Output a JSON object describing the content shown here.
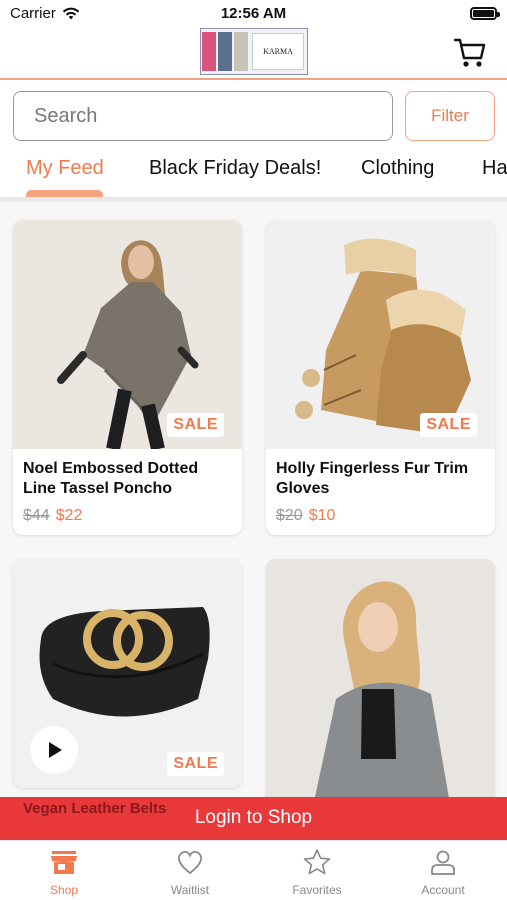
{
  "status_bar": {
    "carrier": "Carrier",
    "time": "12:56 AM"
  },
  "header": {
    "logo_text": "KARMA",
    "cart_icon": "cart-icon"
  },
  "search": {
    "placeholder": "Search",
    "filter_label": "Filter"
  },
  "tabs": [
    {
      "label": "My Feed",
      "active": true
    },
    {
      "label": "Black Friday Deals!",
      "active": false
    },
    {
      "label": "Clothing",
      "active": false
    },
    {
      "label": "Ha",
      "active": false
    }
  ],
  "products": [
    {
      "name": "Noel Embossed Dotted Line Tassel Poncho",
      "old_price": "$44",
      "price": "$22",
      "badge": "SALE"
    },
    {
      "name": "Holly Fingerless Fur Trim Gloves",
      "old_price": "$20",
      "price": "$10",
      "badge": "SALE"
    },
    {
      "name": "Vegan Leather Belts",
      "badge": "SALE",
      "has_video": true
    }
  ],
  "login_banner": {
    "label": "Login to Shop"
  },
  "tabbar": [
    {
      "label": "Shop",
      "icon": "store-icon",
      "active": true
    },
    {
      "label": "Waitlist",
      "icon": "heart-icon",
      "active": false
    },
    {
      "label": "Favorites",
      "icon": "star-icon",
      "active": false
    },
    {
      "label": "Account",
      "icon": "person-icon",
      "active": false
    }
  ],
  "colors": {
    "accent": "#f07a4e",
    "accent_light": "#f6a27e",
    "banner": "#e8383a"
  }
}
